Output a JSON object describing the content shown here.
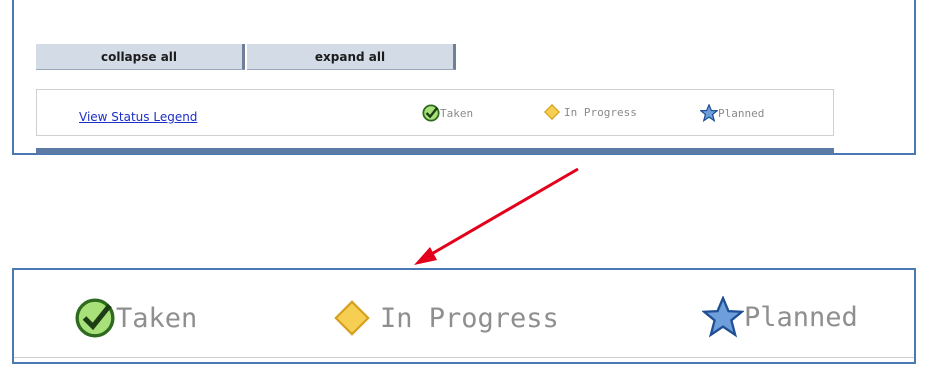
{
  "toolbar": {
    "collapse_label": "collapse all",
    "expand_label": "expand all"
  },
  "legend": {
    "link_label": "View Status Legend",
    "items": [
      {
        "label": "Taken",
        "icon": "checkmark-circle-icon",
        "color": "#4a9a2e"
      },
      {
        "label": "In Progress",
        "icon": "diamond-icon",
        "color": "#f2c23c"
      },
      {
        "label": "Planned",
        "icon": "star-icon",
        "color": "#3a6fb5"
      }
    ]
  },
  "colors": {
    "accent_border": "#4a78b5",
    "arrow": "#e3001b",
    "header_bar": "#5b7aa6"
  }
}
